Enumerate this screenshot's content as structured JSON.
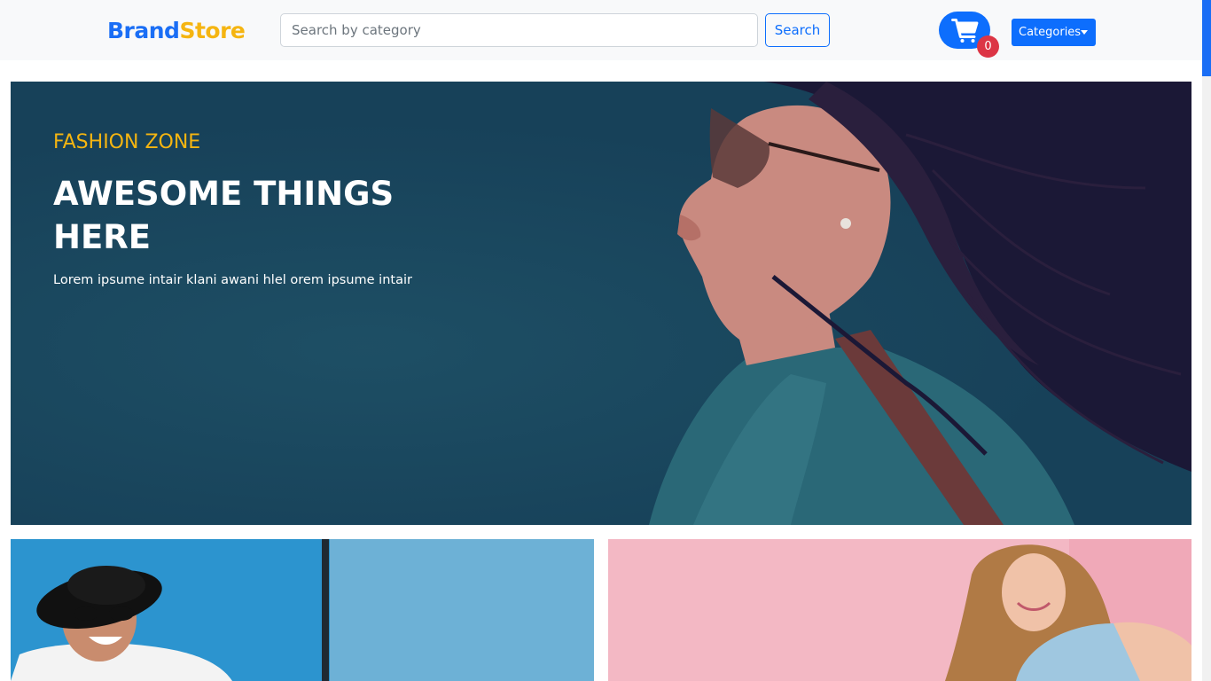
{
  "navbar": {
    "brand_part1": "Brand",
    "brand_part2": "Store",
    "search_placeholder": "Search by category",
    "search_value": "",
    "search_button": "Search",
    "cart_icon": "shopping-cart-icon",
    "cart_count": "0",
    "categories_button": "Categories"
  },
  "hero": {
    "tag": "FASHION ZONE",
    "title": "AWESOME THINGS HERE",
    "subtitle": "Lorem ipsume intair klani awani hlel orem ipsume intair"
  },
  "colors": {
    "brand_blue": "#1a6ef5",
    "brand_yellow": "#f5b511",
    "primary": "#0d6efd",
    "badge_red": "#dc3545",
    "hero_bg": "#174159",
    "card_left_bg": "#2c94cf",
    "card_right_bg": "#f3b8c4"
  }
}
